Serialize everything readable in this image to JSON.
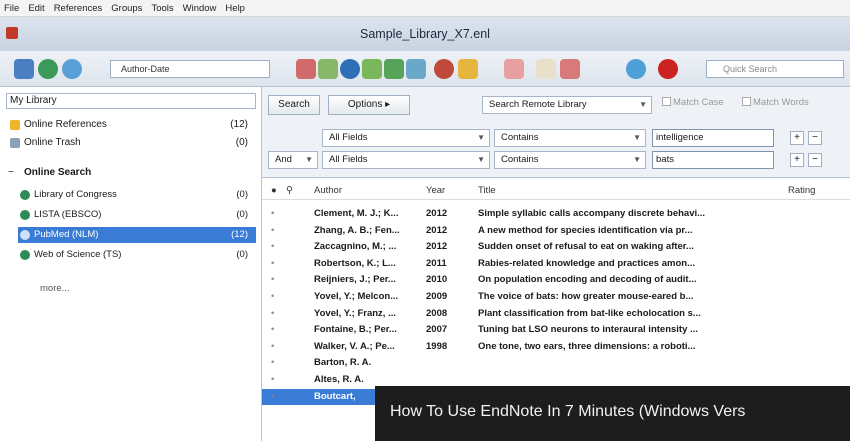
{
  "menu": [
    "File",
    "Edit",
    "References",
    "Groups",
    "Tools",
    "Window",
    "Help"
  ],
  "window": {
    "title": "Sample_Library_X7.enl"
  },
  "toolbar": {
    "style": "Author-Date",
    "quick_search_placeholder": "Quick Search",
    "icons": [
      "library-icon",
      "globe-icon",
      "sync-icon",
      "insert-citation-icon",
      "find-full-text-icon",
      "online-search-icon",
      "new-reference-icon",
      "edit-icon",
      "open-link-icon",
      "import-icon",
      "export-icon",
      "groups-icon",
      "attach-pdf-icon",
      "pdf-icon",
      "help-icon"
    ]
  },
  "sidebar": {
    "header": "My Library",
    "items": [
      {
        "label": "Online References",
        "count": "(12)"
      },
      {
        "label": "Online Trash",
        "count": "(0)"
      }
    ],
    "group": {
      "toggle": "−",
      "label": "Online Search"
    },
    "searches": [
      {
        "label": "Library of Congress",
        "count": "(0)"
      },
      {
        "label": "LISTA (EBSCO)",
        "count": "(0)"
      },
      {
        "label": "PubMed (NLM)",
        "count": "(12)"
      },
      {
        "label": "Web of Science (TS)",
        "count": "(0)"
      }
    ],
    "more": "more..."
  },
  "search_panel": {
    "search_button": "Search",
    "options_button": "Options ▸",
    "remote": "Search Remote Library",
    "match_case": "Match Case",
    "match_words": "Match Words",
    "row1": {
      "field": "All Fields",
      "op": "Contains",
      "value": "intelligence"
    },
    "row2": {
      "bool": "And",
      "field": "All Fields",
      "op": "Contains",
      "value": "bats"
    },
    "plus": "+",
    "minus": "−"
  },
  "list": {
    "columns": {
      "author": "Author",
      "year": "Year",
      "title": "Title",
      "rating": "Rating"
    },
    "rows": [
      {
        "author": "Clement, M. J.; K...",
        "year": "2012",
        "title": "Simple syllabic calls accompany discrete behavi..."
      },
      {
        "author": "Zhang, A. B.; Fen...",
        "year": "2012",
        "title": "A new method for species identification via pr..."
      },
      {
        "author": "Zaccagnino, M.; ...",
        "year": "2012",
        "title": "Sudden onset of refusal to eat on waking after..."
      },
      {
        "author": "Robertson, K.; L...",
        "year": "2011",
        "title": "Rabies-related knowledge and practices amon..."
      },
      {
        "author": "Reijniers, J.; Per...",
        "year": "2010",
        "title": "On population encoding and decoding of audit..."
      },
      {
        "author": "Yovel, Y.; Melcon...",
        "year": "2009",
        "title": "The voice of bats: how greater mouse-eared b..."
      },
      {
        "author": "Yovel, Y.; Franz, ...",
        "year": "2008",
        "title": "Plant classification from bat-like echolocation s..."
      },
      {
        "author": "Fontaine, B.; Per...",
        "year": "2007",
        "title": "Tuning bat LSO neurons to interaural intensity ..."
      },
      {
        "author": "Walker, V. A.; Pe...",
        "year": "1998",
        "title": "One tone, two ears, three dimensions: a roboti..."
      },
      {
        "author": "Barton, R. A.",
        "year": "",
        "title": ""
      },
      {
        "author": "Altes, R. A.",
        "year": "",
        "title": ""
      },
      {
        "author": "Boutcart,",
        "year": "",
        "title": ""
      }
    ]
  },
  "overlay": {
    "text": "How To Use EndNote In 7 Minutes (Windows Vers"
  }
}
